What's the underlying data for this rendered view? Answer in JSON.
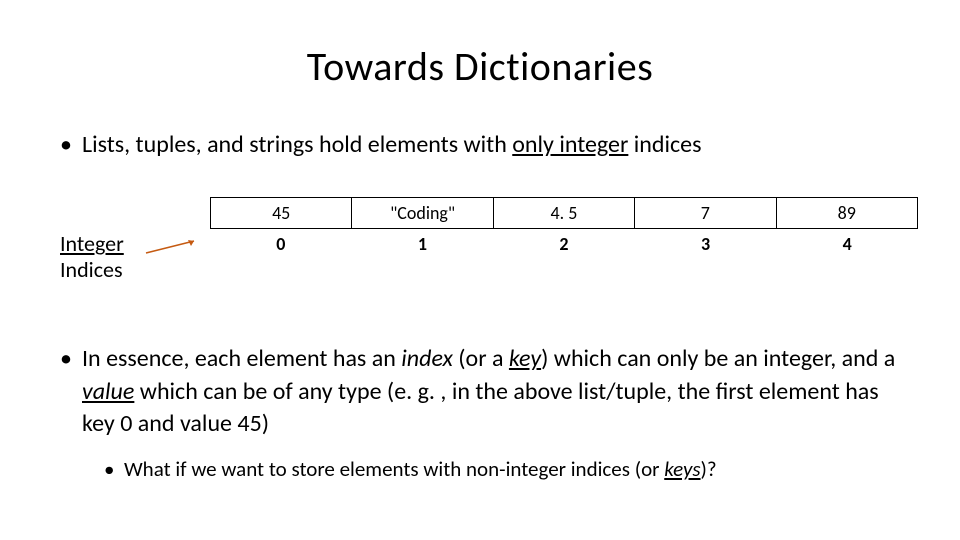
{
  "title": "Towards Dictionaries",
  "bullet1": {
    "dot": "•",
    "pre": "Lists, tuples, and strings hold elements with ",
    "underlined": "only integer",
    "post": " indices"
  },
  "table_label": {
    "l1": "Integer",
    "l2": "Indices"
  },
  "array": {
    "c0": "45",
    "c1": "\"Coding\"",
    "c2": "4. 5",
    "c3": "7",
    "c4": "89"
  },
  "indices": {
    "c0": "0",
    "c1": "1",
    "c2": "2",
    "c3": "3",
    "c4": "4"
  },
  "bullet2": {
    "dot": "•",
    "s0": "In essence, each element has an ",
    "s1_i": "index",
    "s2": " (or a ",
    "s3_iu": "key",
    "s4": ") which can only be an integer, and a ",
    "s5_iu": "value",
    "s6": " which can be of any type (e. g. , in the above list/tuple, the first element has key 0 and value 45)"
  },
  "sub": {
    "dot": "•",
    "s0": "What if we want to store elements with non-integer indices (or ",
    "s1_iu": "keys",
    "s2": ")?"
  }
}
